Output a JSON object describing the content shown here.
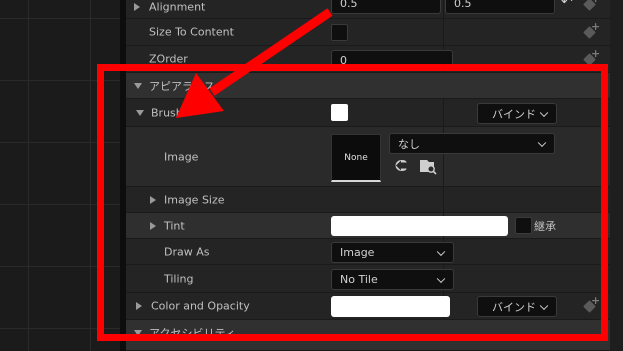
{
  "rows": {
    "alignment": {
      "label": "Alignment",
      "x_value": "0.5",
      "y_value": "0.5"
    },
    "size_to_content": {
      "label": "Size To Content"
    },
    "zorder": {
      "label": "ZOrder",
      "value": "0"
    },
    "appearance": {
      "label": "アピアランス"
    },
    "brush": {
      "label": "Brush",
      "bind_label": "バインド"
    },
    "image": {
      "label": "Image",
      "thumb_label": "None",
      "asset_value": "なし"
    },
    "image_size": {
      "label": "Image Size"
    },
    "tint": {
      "label": "Tint",
      "inherit_label": "継承"
    },
    "draw_as": {
      "label": "Draw As",
      "value": "Image"
    },
    "tiling": {
      "label": "Tiling",
      "value": "No Tile"
    },
    "color_opacity": {
      "label": "Color and Opacity",
      "bind_label": "バインド"
    },
    "accessibility": {
      "label": "アクセシビリティ"
    }
  },
  "colors": {
    "highlight": "#ff0000",
    "panel": "#242424"
  },
  "icons": [
    "reset-arrow-icon",
    "add-property-icon",
    "use-selected-asset-icon",
    "browse-asset-icon",
    "chevron-down-icon"
  ]
}
